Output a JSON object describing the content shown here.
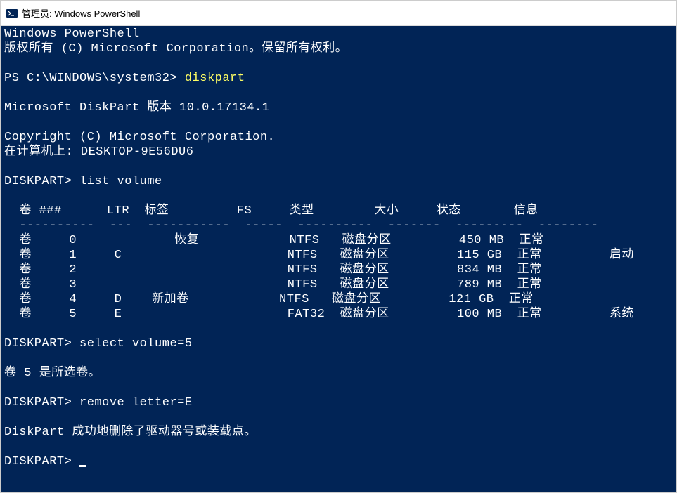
{
  "titlebar": {
    "text": "管理员: Windows PowerShell"
  },
  "console": {
    "header_line1": "Windows PowerShell",
    "header_line2": "版权所有 (C) Microsoft Corporation。保留所有权利。",
    "ps_prompt": "PS C:\\WINDOWS\\system32>",
    "cmd_diskpart": "diskpart",
    "dp_version": "Microsoft DiskPart 版本 10.0.17134.1",
    "dp_copyright": "Copyright (C) Microsoft Corporation.",
    "dp_computer": "在计算机上: DESKTOP-9E56DU6",
    "dp_prompt": "DISKPART>",
    "cmd_listvol": "list volume",
    "table_header": "  卷 ###      LTR  标签         FS     类型        大小     状态       信息",
    "table_divider": "  ----------  ---  -----------  -----  ----------  -------  ---------  --------",
    "volumes": [
      {
        "num": "0",
        "ltr": "",
        "label": "恢复",
        "fs": "NTFS",
        "type": "磁盘分区",
        "size": "450 MB",
        "status": "正常",
        "info": ""
      },
      {
        "num": "1",
        "ltr": "C",
        "label": "",
        "fs": "NTFS",
        "type": "磁盘分区",
        "size": "115 GB",
        "status": "正常",
        "info": "启动"
      },
      {
        "num": "2",
        "ltr": "",
        "label": "",
        "fs": "NTFS",
        "type": "磁盘分区",
        "size": "834 MB",
        "status": "正常",
        "info": ""
      },
      {
        "num": "3",
        "ltr": "",
        "label": "",
        "fs": "NTFS",
        "type": "磁盘分区",
        "size": "789 MB",
        "status": "正常",
        "info": ""
      },
      {
        "num": "4",
        "ltr": "D",
        "label": "新加卷",
        "fs": "NTFS",
        "type": "磁盘分区",
        "size": "121 GB",
        "status": "正常",
        "info": ""
      },
      {
        "num": "5",
        "ltr": "E",
        "label": "",
        "fs": "FAT32",
        "type": "磁盘分区",
        "size": "100 MB",
        "status": "正常",
        "info": "系统"
      }
    ],
    "row0": "  卷     0             恢复            NTFS   磁盘分区         450 MB  正常",
    "row1": "  卷     1     C                      NTFS   磁盘分区         115 GB  正常         启动",
    "row2": "  卷     2                            NTFS   磁盘分区         834 MB  正常",
    "row3": "  卷     3                            NTFS   磁盘分区         789 MB  正常",
    "row4": "  卷     4     D    新加卷            NTFS   磁盘分区         121 GB  正常",
    "row5": "  卷     5     E                      FAT32  磁盘分区         100 MB  正常         系统",
    "cmd_selectvol": "select volume=5",
    "msg_selected": "卷 5 是所选卷。",
    "cmd_removelet": "remove letter=E",
    "msg_removed": "DiskPart 成功地删除了驱动器号或装载点。"
  }
}
